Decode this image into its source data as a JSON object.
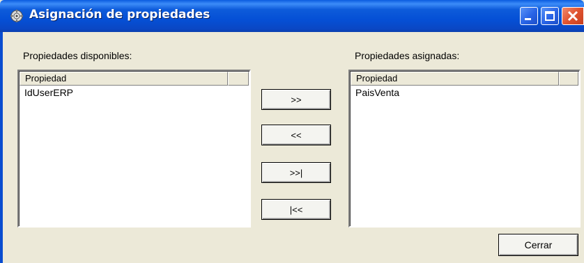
{
  "window": {
    "title": "Asignación de propiedades",
    "title_bar_color": "#0A5CE0",
    "icon": "gear-icon",
    "controls": {
      "minimize_icon": "minimize-icon",
      "maximize_icon": "maximize-icon",
      "close_icon": "close-icon"
    }
  },
  "available": {
    "label": "Propiedades disponibles:",
    "column_header": "Propiedad",
    "items": [
      "IdUserERP"
    ]
  },
  "assigned": {
    "label": "Propiedades asignadas:",
    "column_header": "Propiedad",
    "items": [
      "PaisVenta"
    ]
  },
  "transfer_buttons": {
    "add_selected": ">>",
    "remove_selected": "<<",
    "add_all": ">>|",
    "remove_all": "|<<"
  },
  "footer": {
    "close_label": "Cerrar"
  }
}
